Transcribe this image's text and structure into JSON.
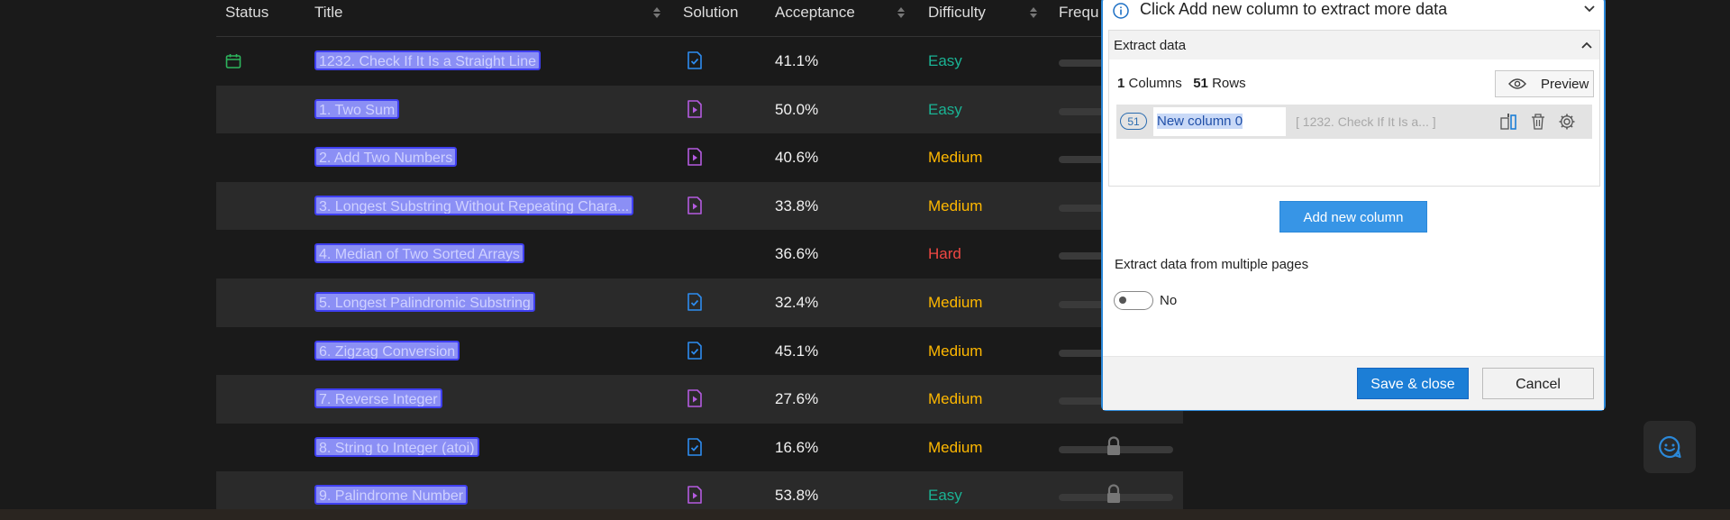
{
  "table": {
    "headers": {
      "status": "Status",
      "title": "Title",
      "solution": "Solution",
      "acceptance": "Acceptance",
      "difficulty": "Difficulty",
      "frequency": "Frequ"
    },
    "rows": [
      {
        "title": "1232. Check If It Is a Straight Line",
        "solution": "article",
        "acceptance": "41.1%",
        "difficulty": "Easy",
        "status": "calendar"
      },
      {
        "title": "1. Two Sum",
        "solution": "video",
        "acceptance": "50.0%",
        "difficulty": "Easy"
      },
      {
        "title": "2. Add Two Numbers",
        "solution": "video",
        "acceptance": "40.6%",
        "difficulty": "Medium"
      },
      {
        "title": "3. Longest Substring Without Repeating Chara...",
        "solution": "video",
        "acceptance": "33.8%",
        "difficulty": "Medium"
      },
      {
        "title": "4. Median of Two Sorted Arrays",
        "solution": "",
        "acceptance": "36.6%",
        "difficulty": "Hard"
      },
      {
        "title": "5. Longest Palindromic Substring",
        "solution": "article",
        "acceptance": "32.4%",
        "difficulty": "Medium"
      },
      {
        "title": "6. Zigzag Conversion",
        "solution": "article",
        "acceptance": "45.1%",
        "difficulty": "Medium"
      },
      {
        "title": "7. Reverse Integer",
        "solution": "video",
        "acceptance": "27.6%",
        "difficulty": "Medium"
      },
      {
        "title": "8. String to Integer (atoi)",
        "solution": "article",
        "acceptance": "16.6%",
        "difficulty": "Medium",
        "locked": true
      },
      {
        "title": "9. Palindrome Number",
        "solution": "video",
        "acceptance": "53.8%",
        "difficulty": "Easy",
        "locked": true
      }
    ]
  },
  "dialog": {
    "info_text": "Click Add new column to extract more data",
    "section_title": "Extract data",
    "columns_count": "1",
    "columns_label": "Columns",
    "rows_count": "51",
    "rows_label": "Rows",
    "preview_label": "Preview",
    "column": {
      "badge": "51",
      "name": "New column 0",
      "preview": "[ 1232. Check If It Is a... ]"
    },
    "add_column_label": "Add new column",
    "multi_pages_label": "Extract data from multiple pages",
    "toggle_value": "No",
    "save_label": "Save & close",
    "cancel_label": "Cancel"
  },
  "colors": {
    "easy": "#1ab394",
    "medium": "#ffb800",
    "hard": "#ef4743",
    "accent": "#1c7ed6"
  }
}
